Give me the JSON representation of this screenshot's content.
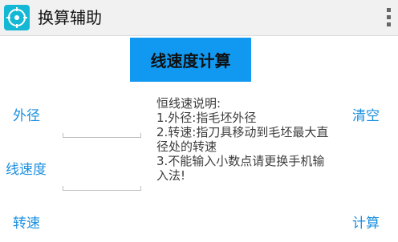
{
  "app": {
    "title": "换算辅助",
    "icon": "compass-icon"
  },
  "header": {
    "title_button": "线速度计算"
  },
  "fields": [
    {
      "label": "外径",
      "value": ""
    },
    {
      "label": "线速度",
      "value": ""
    },
    {
      "label": "转速",
      "value": ""
    }
  ],
  "description": "恒线速说明:\n1.外径:指毛坯外径\n2.转速:指刀具移动到毛坯最大直径处的转速\n3.不能输入小数点请更换手机输入法!",
  "actions": {
    "clear": "清空",
    "calculate": "计算"
  },
  "colors": {
    "accent": "#1198f0",
    "label": "#1a8fe0",
    "icon_bg": "#14b8d4"
  }
}
